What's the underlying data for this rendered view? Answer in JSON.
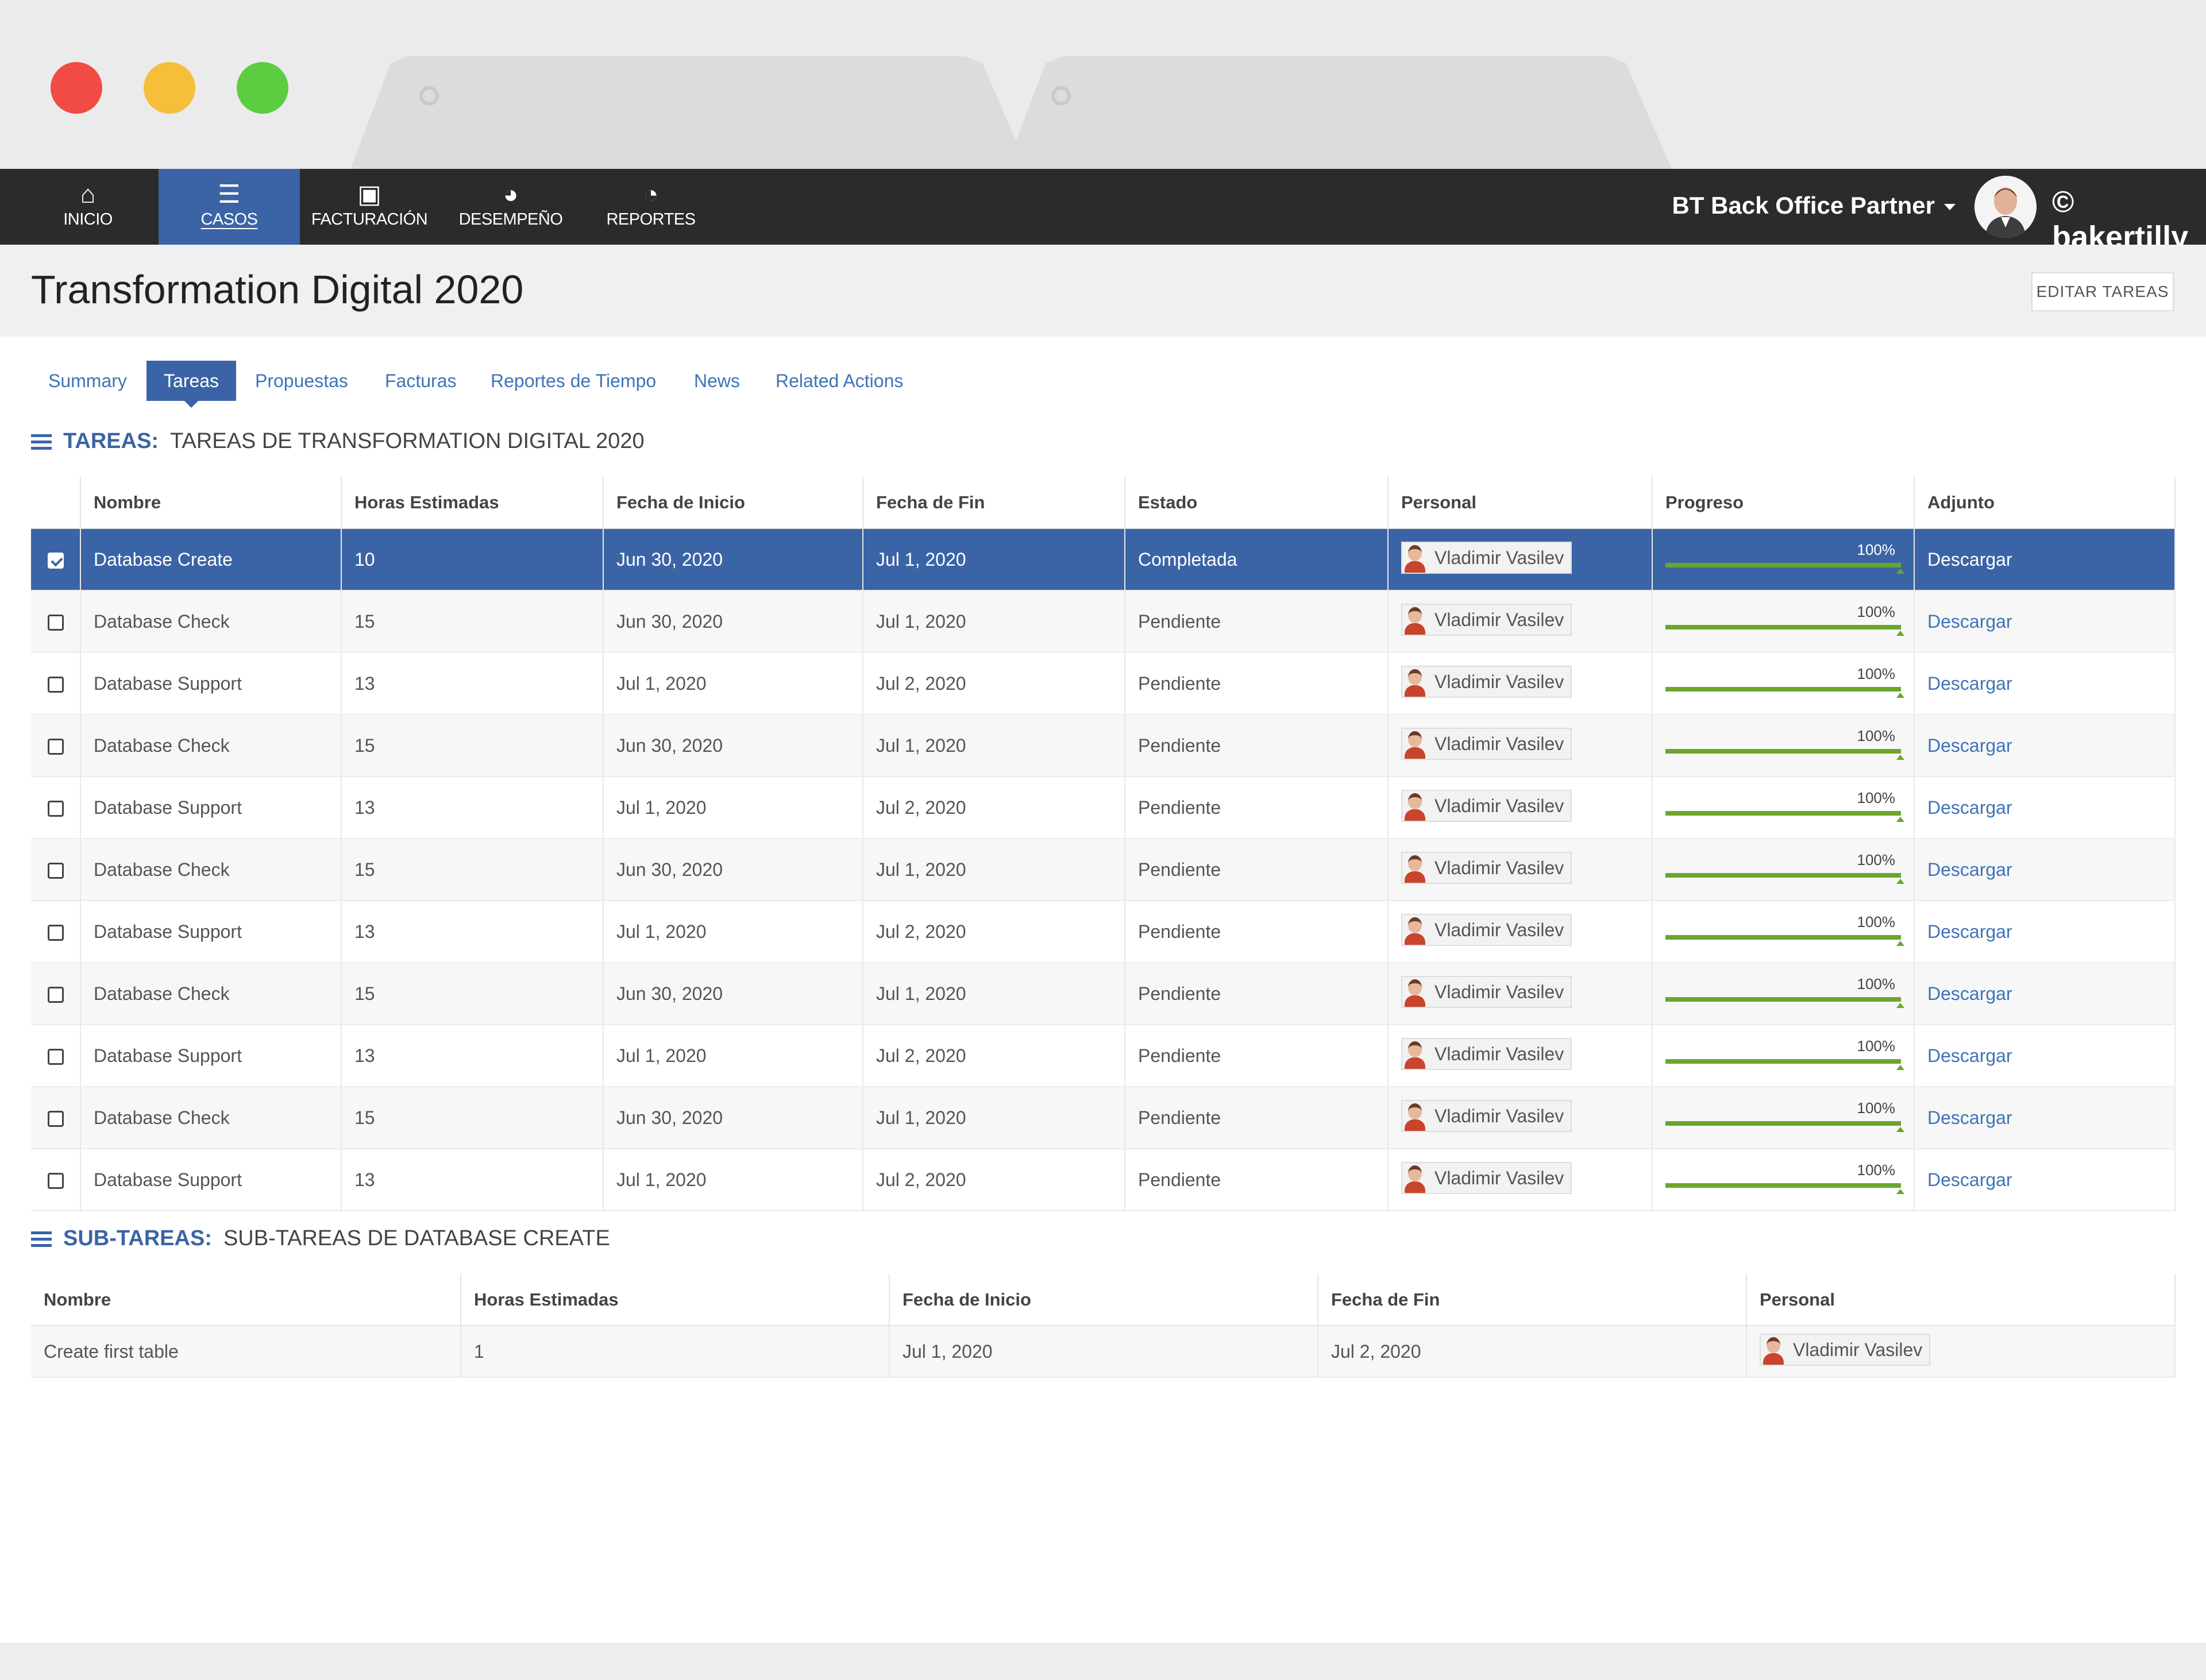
{
  "app": {
    "nav": [
      {
        "label": "INICIO",
        "icon": "home-icon"
      },
      {
        "label": "CASOS",
        "icon": "list-icon"
      },
      {
        "label": "FACTURACIÓN",
        "icon": "money-icon"
      },
      {
        "label": "DESEMPEÑO",
        "icon": "dashboard-icon"
      },
      {
        "label": "REPORTES",
        "icon": "pie-chart-icon"
      }
    ],
    "active_nav": "CASOS",
    "partner_label": "BT Back Office Partner",
    "brand": "bakertilly",
    "colors": {
      "nav_bg": "#2b2b2b",
      "accent": "#3b64a6",
      "progress": "#6aa62d",
      "link": "#3f74b8"
    }
  },
  "page": {
    "title": "Transformation Digital 2020",
    "edit_button": "EDITAR TAREAS",
    "tabs": [
      "Summary",
      "Tareas",
      "Propuestas",
      "Facturas",
      "Reportes de Tiempo",
      "News",
      "Related Actions"
    ],
    "active_tab": "Tareas"
  },
  "tasks": {
    "heading_key": "TAREAS:",
    "heading_value": "TAREAS DE TRANSFORMATION DIGITAL 2020",
    "columns": [
      "Nombre",
      "Horas Estimadas",
      "Fecha de Inicio",
      "Fecha de Fin",
      "Estado",
      "Personal",
      "Progreso",
      "Adjunto"
    ],
    "rows": [
      {
        "checked": true,
        "name": "Database Create",
        "hours": "10",
        "start": "Jun 30, 2020",
        "end": "Jul 1, 2020",
        "status": "Completada",
        "person": "Vladimir Vasilev",
        "progress_label": "100%",
        "progress": 1.0,
        "attachment": "Descargar"
      },
      {
        "checked": false,
        "name": "Database Check",
        "hours": "15",
        "start": "Jun 30, 2020",
        "end": "Jul 1, 2020",
        "status": "Pendiente",
        "person": "Vladimir Vasilev",
        "progress_label": "100%",
        "progress": 1.0,
        "attachment": "Descargar"
      },
      {
        "checked": false,
        "name": "Database Support",
        "hours": "13",
        "start": "Jul 1, 2020",
        "end": "Jul 2, 2020",
        "status": "Pendiente",
        "person": "Vladimir Vasilev",
        "progress_label": "100%",
        "progress": 1.0,
        "attachment": "Descargar"
      },
      {
        "checked": false,
        "name": "Database Check",
        "hours": "15",
        "start": "Jun 30, 2020",
        "end": "Jul 1, 2020",
        "status": "Pendiente",
        "person": "Vladimir Vasilev",
        "progress_label": "100%",
        "progress": 1.0,
        "attachment": "Descargar"
      },
      {
        "checked": false,
        "name": "Database Support",
        "hours": "13",
        "start": "Jul 1, 2020",
        "end": "Jul 2, 2020",
        "status": "Pendiente",
        "person": "Vladimir Vasilev",
        "progress_label": "100%",
        "progress": 1.0,
        "attachment": "Descargar"
      },
      {
        "checked": false,
        "name": "Database Check",
        "hours": "15",
        "start": "Jun 30, 2020",
        "end": "Jul 1, 2020",
        "status": "Pendiente",
        "person": "Vladimir Vasilev",
        "progress_label": "100%",
        "progress": 1.0,
        "attachment": "Descargar"
      },
      {
        "checked": false,
        "name": "Database Support",
        "hours": "13",
        "start": "Jul 1, 2020",
        "end": "Jul 2, 2020",
        "status": "Pendiente",
        "person": "Vladimir Vasilev",
        "progress_label": "100%",
        "progress": 1.0,
        "attachment": "Descargar"
      },
      {
        "checked": false,
        "name": "Database Check",
        "hours": "15",
        "start": "Jun 30, 2020",
        "end": "Jul 1, 2020",
        "status": "Pendiente",
        "person": "Vladimir Vasilev",
        "progress_label": "100%",
        "progress": 1.0,
        "attachment": "Descargar"
      },
      {
        "checked": false,
        "name": "Database Support",
        "hours": "13",
        "start": "Jul 1, 2020",
        "end": "Jul 2, 2020",
        "status": "Pendiente",
        "person": "Vladimir Vasilev",
        "progress_label": "100%",
        "progress": 1.0,
        "attachment": "Descargar"
      },
      {
        "checked": false,
        "name": "Database Check",
        "hours": "15",
        "start": "Jun 30, 2020",
        "end": "Jul 1, 2020",
        "status": "Pendiente",
        "person": "Vladimir Vasilev",
        "progress_label": "100%",
        "progress": 1.0,
        "attachment": "Descargar"
      },
      {
        "checked": false,
        "name": "Database Support",
        "hours": "13",
        "start": "Jul 1, 2020",
        "end": "Jul 2, 2020",
        "status": "Pendiente",
        "person": "Vladimir Vasilev",
        "progress_label": "100%",
        "progress": 1.0,
        "attachment": "Descargar"
      }
    ]
  },
  "subtasks": {
    "heading_key": "SUB-TAREAS:",
    "heading_value": "SUB-TAREAS DE DATABASE CREATE",
    "columns": [
      "Nombre",
      "Horas Estimadas",
      "Fecha de Inicio",
      "Fecha de Fin",
      "Personal"
    ],
    "rows": [
      {
        "name": "Create first table",
        "hours": "1",
        "start": "Jul 1, 2020",
        "end": "Jul 2, 2020",
        "person": "Vladimir Vasilev"
      }
    ]
  }
}
